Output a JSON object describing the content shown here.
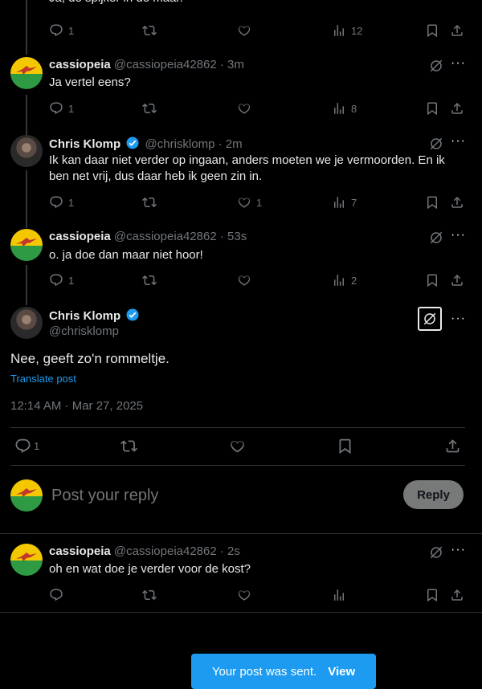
{
  "posts": [
    {
      "user": "",
      "handle": "",
      "time": "",
      "text": "Ja, de spijker in de maar.",
      "replies": "1",
      "views": "12"
    },
    {
      "user": "cassiopeia",
      "handle": "@cassiopeia42862",
      "time": "· 3m",
      "text": "Ja vertel eens?",
      "replies": "1",
      "views": "8"
    },
    {
      "user": "Chris Klomp",
      "handle": "@chrisklomp",
      "time": "· 2m",
      "text": "Ik kan daar niet verder op ingaan, anders moeten we je vermoorden. En ik ben net vrij, dus daar heb ik geen zin in.",
      "replies": "1",
      "likes": "1",
      "views": "7"
    },
    {
      "user": "cassiopeia",
      "handle": "@cassiopeia42862",
      "time": "· 53s",
      "text": "o. ja doe dan maar niet hoor!",
      "replies": "1",
      "views": "2"
    }
  ],
  "main_post": {
    "user": "Chris Klomp",
    "handle": "@chrisklomp",
    "text": "Nee, geeft zo'n rommeltje.",
    "translate": "Translate post",
    "timestamp": "12:14 AM · Mar 27, 2025",
    "replies": "1"
  },
  "composer": {
    "placeholder": "Post your reply",
    "button": "Reply"
  },
  "reply_post": {
    "user": "cassiopeia",
    "handle": "@cassiopeia42862",
    "time": "· 2s",
    "text": "oh en wat doe je verder voor de kost?"
  },
  "toast": {
    "message": "Your post was sent.",
    "action": "View"
  },
  "colors": {
    "accent": "#1d9bf0",
    "background": "#000000",
    "muted": "#71767b"
  }
}
